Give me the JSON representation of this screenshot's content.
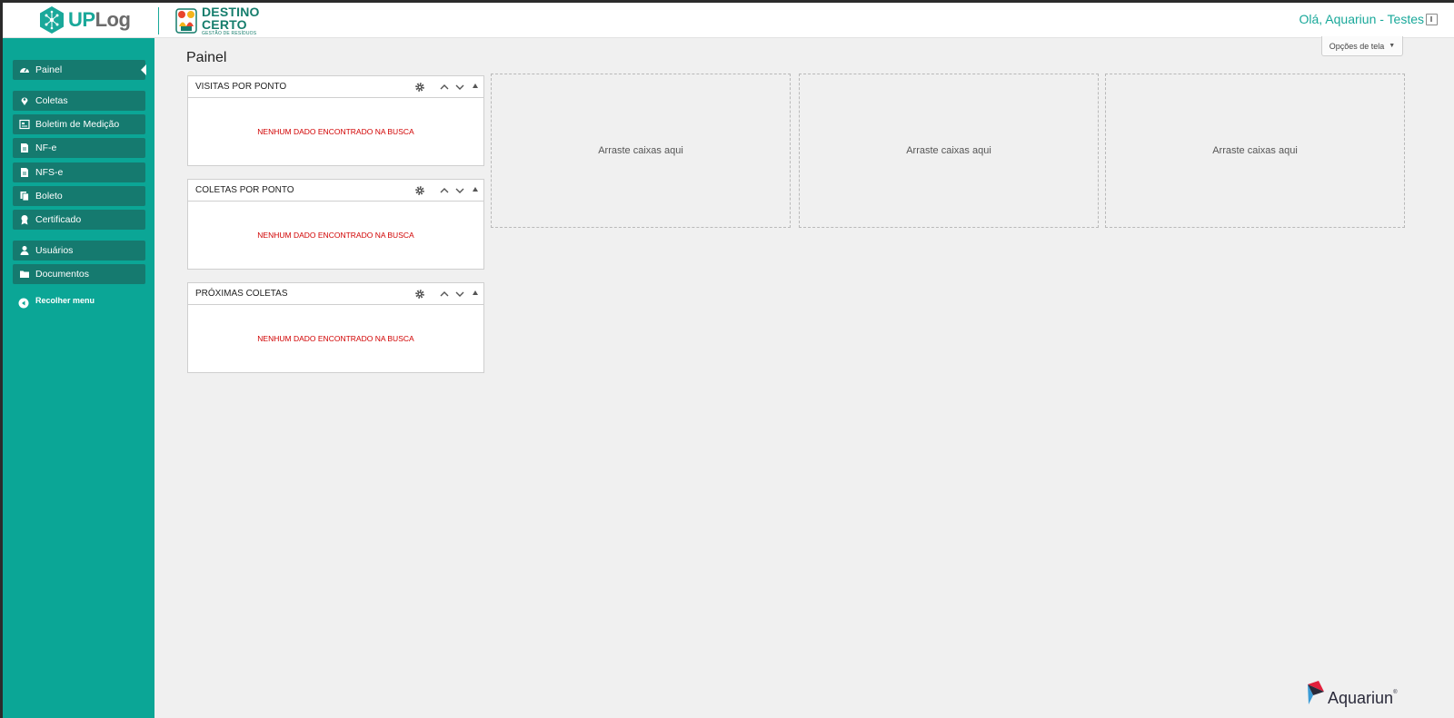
{
  "header": {
    "brand_up": "UP",
    "brand_log": "Log",
    "partner_line1": "DESTINO",
    "partner_line2": "CERTO",
    "partner_tagline": "GESTÃO DE RESÍDUOS",
    "greeting": "Olá, Aquariun - Testes"
  },
  "sidebar": {
    "items": [
      {
        "label": "Painel",
        "icon": "dashboard-icon"
      },
      {
        "label": "Coletas",
        "icon": "map-pin-icon"
      },
      {
        "label": "Boletim de Medição",
        "icon": "report-icon"
      },
      {
        "label": "NF-e",
        "icon": "document-icon"
      },
      {
        "label": "NFS-e",
        "icon": "document-icon"
      },
      {
        "label": "Boleto",
        "icon": "copy-icon"
      },
      {
        "label": "Certificado",
        "icon": "award-icon"
      },
      {
        "label": "Usuários",
        "icon": "user-icon"
      },
      {
        "label": "Documentos",
        "icon": "folder-icon"
      }
    ],
    "collapse_label": "Recolher menu"
  },
  "main": {
    "page_title": "Painel",
    "screen_options_label": "Opções de tela",
    "widgets": [
      {
        "title": "VISITAS POR PONTO",
        "empty_message": "NENHUM DADO ENCONTRADO NA BUSCA"
      },
      {
        "title": "COLETAS POR PONTO",
        "empty_message": "NENHUM DADO ENCONTRADO NA BUSCA"
      },
      {
        "title": "PRÓXIMAS COLETAS",
        "empty_message": "NENHUM DADO ENCONTRADO NA BUSCA"
      }
    ],
    "dropzones": [
      "Arraste caixas aqui",
      "Arraste caixas aqui",
      "Arraste caixas aqui"
    ]
  },
  "footer": {
    "vendor_logo": "Aquariun",
    "vendor_reg": "®"
  },
  "colors": {
    "accent": "#0ba696",
    "nav_item": "#157a6f",
    "error_text": "#d10000"
  }
}
